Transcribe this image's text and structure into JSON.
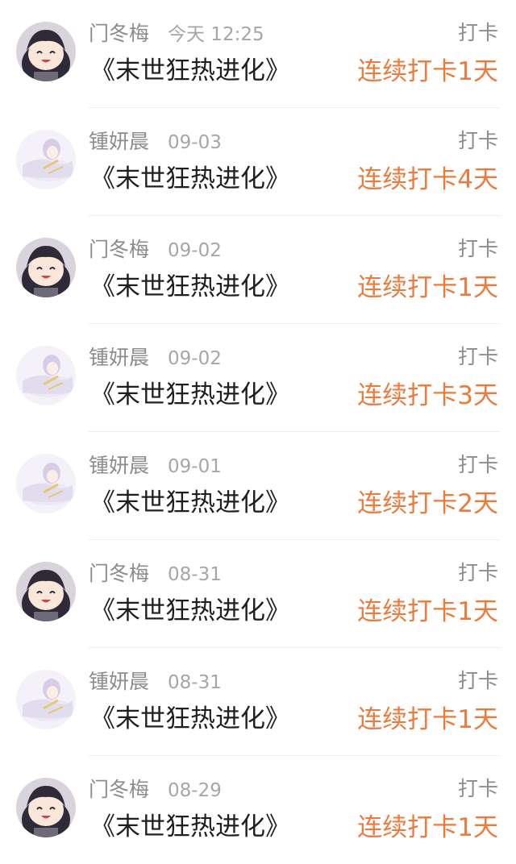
{
  "colors": {
    "streak_accent": "#ed7a3b",
    "meta_text": "#8c8c8c",
    "title_text": "#1f1f1f"
  },
  "feed": [
    {
      "avatar": "dark-haired-anime-girl-avatar",
      "username": "门冬梅",
      "time": "今天 12:25",
      "type": "打卡",
      "book": "《末世狂热进化》",
      "streak": "连续打卡1天"
    },
    {
      "avatar": "white-haired-anime-character-avatar",
      "username": "锺妍晨",
      "time": "09-03",
      "type": "打卡",
      "book": "《末世狂热进化》",
      "streak": "连续打卡4天"
    },
    {
      "avatar": "dark-haired-anime-girl-avatar",
      "username": "门冬梅",
      "time": "09-02",
      "type": "打卡",
      "book": "《末世狂热进化》",
      "streak": "连续打卡1天"
    },
    {
      "avatar": "white-haired-anime-character-avatar",
      "username": "锺妍晨",
      "time": "09-02",
      "type": "打卡",
      "book": "《末世狂热进化》",
      "streak": "连续打卡3天"
    },
    {
      "avatar": "white-haired-anime-character-avatar",
      "username": "锺妍晨",
      "time": "09-01",
      "type": "打卡",
      "book": "《末世狂热进化》",
      "streak": "连续打卡2天"
    },
    {
      "avatar": "dark-haired-anime-girl-avatar",
      "username": "门冬梅",
      "time": "08-31",
      "type": "打卡",
      "book": "《末世狂热进化》",
      "streak": "连续打卡1天"
    },
    {
      "avatar": "white-haired-anime-character-avatar",
      "username": "锺妍晨",
      "time": "08-31",
      "type": "打卡",
      "book": "《末世狂热进化》",
      "streak": "连续打卡1天"
    },
    {
      "avatar": "dark-haired-anime-girl-avatar",
      "username": "门冬梅",
      "time": "08-29",
      "type": "打卡",
      "book": "《末世狂热进化》",
      "streak": "连续打卡1天"
    }
  ]
}
